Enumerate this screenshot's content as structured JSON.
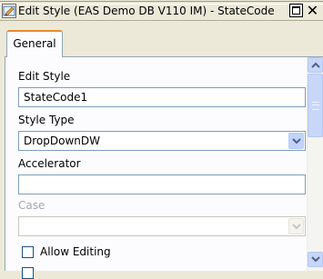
{
  "window": {
    "title": "Edit Style (EAS Demo DB V110 IM) - StateCode",
    "close_glyph": "✕"
  },
  "tabs": [
    {
      "label": "General",
      "selected": true
    }
  ],
  "form": {
    "edit_style_label": "Edit Style",
    "edit_style_value": "StateCode1",
    "style_type_label": "Style Type",
    "style_type_value": "DropDownDW",
    "accelerator_label": "Accelerator",
    "accelerator_value": "",
    "case_label": "Case",
    "case_value": "",
    "allow_editing_label": "Allow Editing",
    "allow_editing_checked": false
  },
  "icons": {
    "window_icon": "edit-style-icon",
    "maximize": "maximize-icon",
    "close": "close-icon",
    "dropdown": "chevron-down-icon",
    "scroll_up": "scroll-up-arrow-icon",
    "scroll_down": "scroll-down-arrow-icon"
  },
  "colors": {
    "window_bg": "#ece9d8",
    "panel_bg": "#fcfcfe",
    "tab_highlight": "#e68b2c",
    "input_border": "#7f9db9",
    "disabled_text": "#a7a6aa"
  }
}
